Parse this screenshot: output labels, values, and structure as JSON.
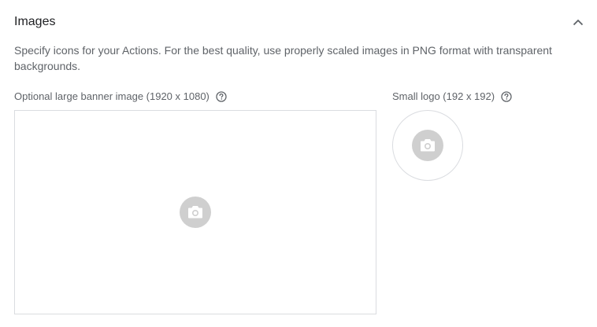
{
  "section": {
    "title": "Images",
    "description": "Specify icons for your Actions. For the best quality, use properly scaled images in PNG format with transparent backgrounds."
  },
  "banner": {
    "label": "Optional large banner image (1920 x 1080)"
  },
  "logo": {
    "label": "Small logo (192 x 192)"
  },
  "icons": {
    "collapse": "chevron-up-icon",
    "help": "help-circle-icon",
    "upload": "camera-icon"
  },
  "colors": {
    "placeholder_circle": "#cfcfcf",
    "border": "#dadce0",
    "secondary_text": "#5f6368"
  }
}
